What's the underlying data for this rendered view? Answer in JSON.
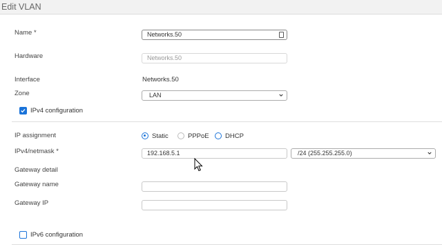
{
  "page": {
    "title": "Edit VLAN"
  },
  "form": {
    "name": {
      "label": "Name *",
      "value": "Networks.50"
    },
    "hardware": {
      "label": "Hardware",
      "placeholder": "Networks.50"
    },
    "interface": {
      "label": "Interface",
      "value": "Networks.50"
    },
    "zone": {
      "label": "Zone",
      "value": "LAN"
    },
    "ipv4_config": {
      "label": "IPv4 configuration",
      "checked": true
    },
    "ip_assignment": {
      "label": "IP assignment",
      "options": [
        "Static",
        "PPPoE",
        "DHCP"
      ],
      "selected": "Static"
    },
    "ipv4_netmask": {
      "label": "IPv4/netmask *",
      "ip": "192.168.5.1",
      "netmask": "/24 (255.255.255.0)"
    },
    "gateway_detail": {
      "label": "Gateway detail"
    },
    "gateway_name": {
      "label": "Gateway name",
      "value": ""
    },
    "gateway_ip": {
      "label": "Gateway IP",
      "value": ""
    },
    "ipv6_config": {
      "label": "IPv6 configuration",
      "checked": false
    }
  },
  "colors": {
    "accent": "#1a73d9",
    "header_bg": "#f2f2f2"
  }
}
